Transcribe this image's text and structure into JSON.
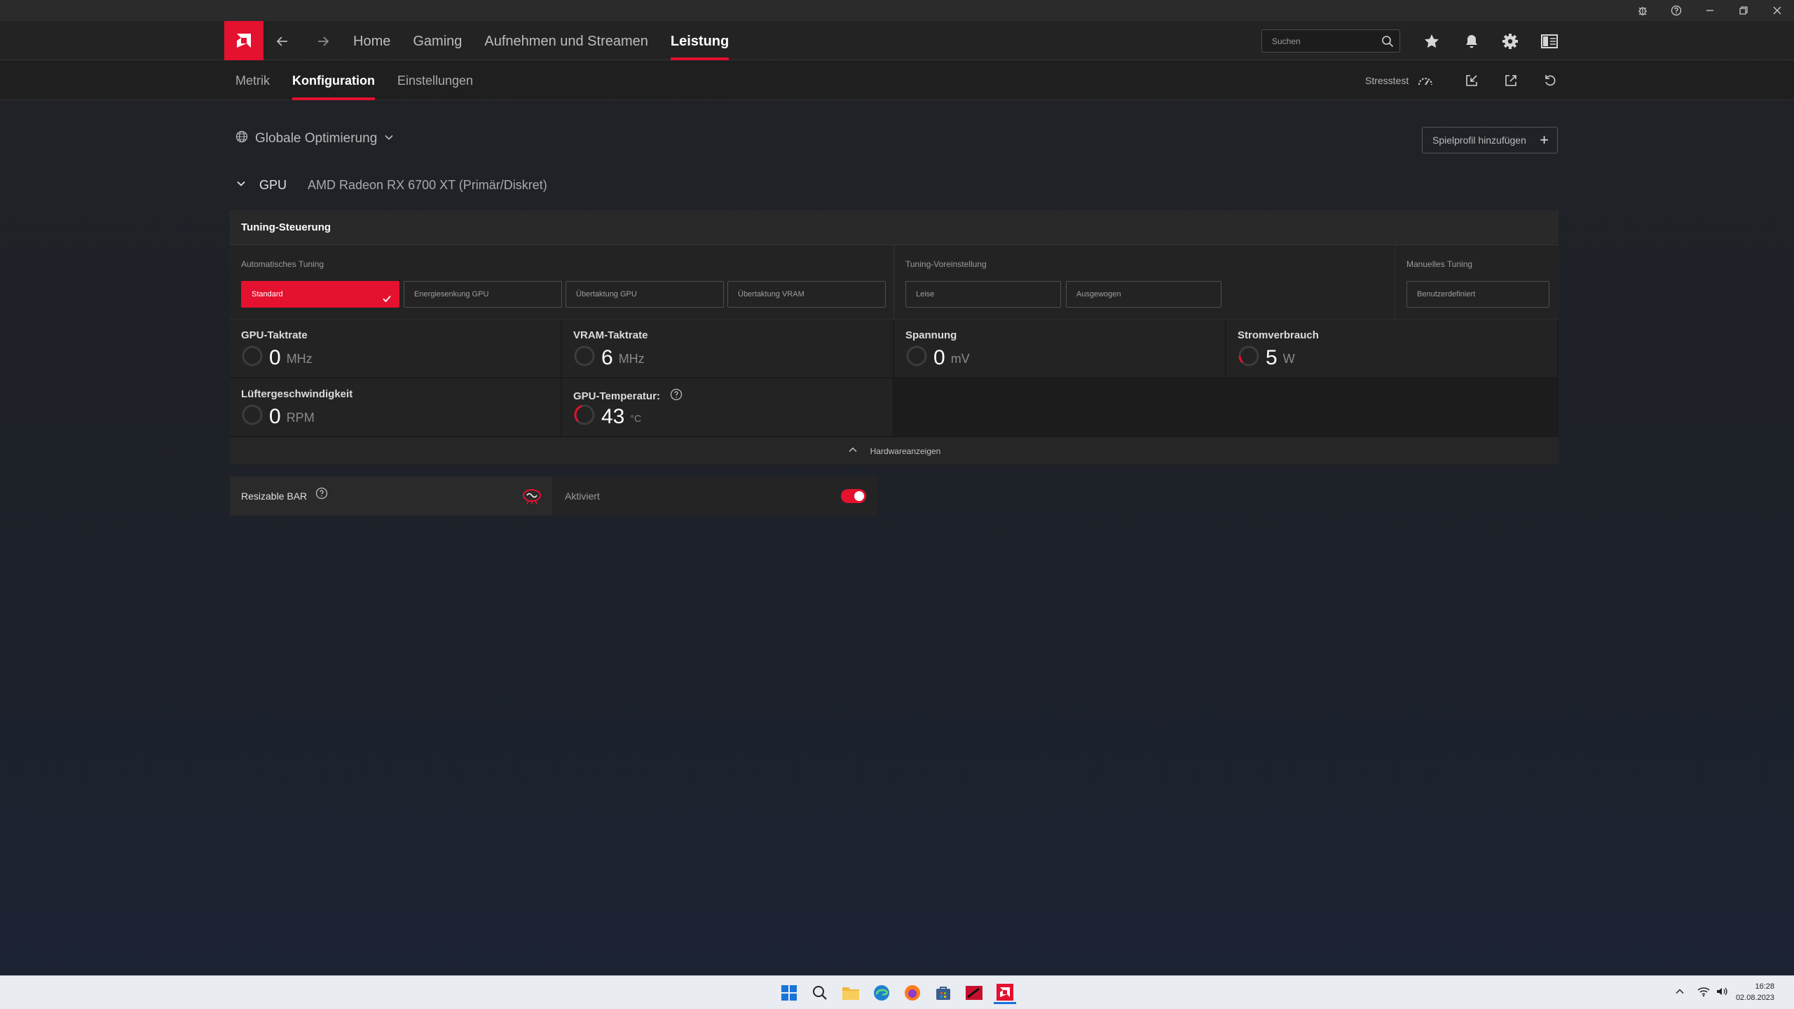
{
  "nav": {
    "tabs": [
      {
        "label": "Home"
      },
      {
        "label": "Gaming"
      },
      {
        "label": "Aufnehmen und Streamen"
      },
      {
        "label": "Leistung"
      }
    ],
    "search_placeholder": "Suchen"
  },
  "subnav": {
    "tabs": [
      {
        "label": "Metrik"
      },
      {
        "label": "Konfiguration"
      },
      {
        "label": "Einstellungen"
      }
    ],
    "stresstest_label": "Stresstest"
  },
  "profile": {
    "label": "Globale Optimierung",
    "add_label": "Spielprofil hinzufügen"
  },
  "gpu": {
    "label": "GPU",
    "name": "AMD Radeon RX 6700 XT (Primär/Diskret)"
  },
  "tuning": {
    "title": "Tuning-Steuerung",
    "auto_label": "Automatisches Tuning",
    "auto_buttons": [
      "Standard",
      "Energiesenkung GPU",
      "Übertaktung GPU",
      "Übertaktung VRAM"
    ],
    "preset_label": "Tuning-Voreinstellung",
    "preset_buttons": [
      "Leise",
      "Ausgewogen"
    ],
    "manual_label": "Manuelles Tuning",
    "manual_button": "Benutzerdefiniert"
  },
  "metrics": [
    {
      "label": "GPU-Taktrate",
      "value": "0",
      "unit": "MHz"
    },
    {
      "label": "VRAM-Taktrate",
      "value": "6",
      "unit": "MHz"
    },
    {
      "label": "Spannung",
      "value": "0",
      "unit": "mV"
    },
    {
      "label": "Stromverbrauch",
      "value": "5",
      "unit": "W"
    },
    {
      "label": "Lüftergeschwindigkeit",
      "value": "0",
      "unit": "RPM"
    },
    {
      "label": "GPU-Temperatur:",
      "value": "43",
      "unit": "°C"
    }
  ],
  "hardware_toggle_label": "Hardwareanzeigen",
  "resizable_bar": {
    "label": "Resizable BAR",
    "status": "Aktiviert"
  },
  "clock": {
    "time": "16:28",
    "date": "02.08.2023"
  },
  "colors": {
    "accent": "#e4112f",
    "background": "#1f2229",
    "panel": "#232323"
  }
}
